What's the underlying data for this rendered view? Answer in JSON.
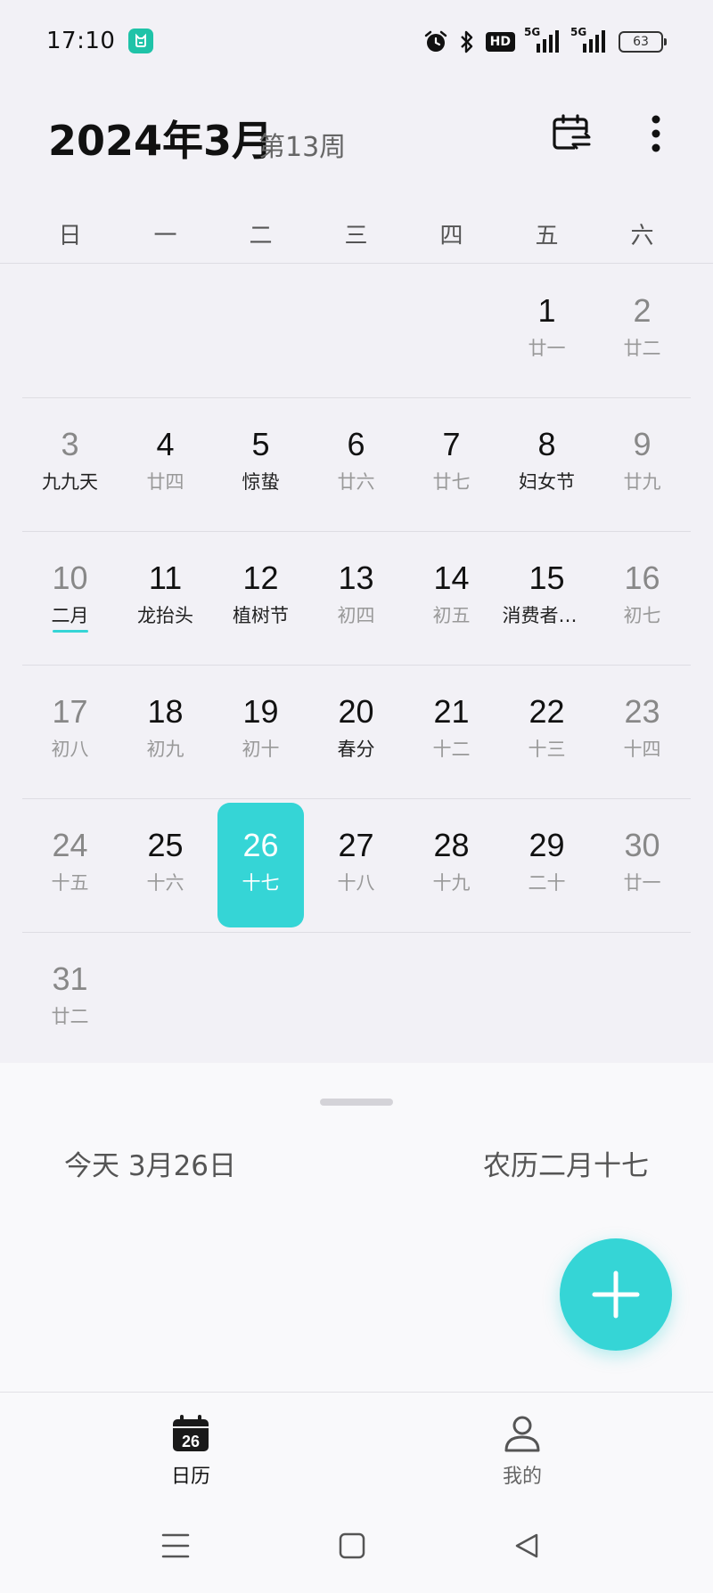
{
  "status_bar": {
    "time": "17:10",
    "hd_label": "HD",
    "sim1_label": "5G",
    "sim2_label": "5G",
    "battery": "63"
  },
  "header": {
    "title": "2024年3月",
    "week": "第13周"
  },
  "weekdays": [
    "日",
    "一",
    "二",
    "三",
    "四",
    "五",
    "六"
  ],
  "weeks": [
    [
      {
        "day": "",
        "lunar": ""
      },
      {
        "day": "",
        "lunar": ""
      },
      {
        "day": "",
        "lunar": ""
      },
      {
        "day": "",
        "lunar": ""
      },
      {
        "day": "",
        "lunar": ""
      },
      {
        "day": "1",
        "lunar": "廿一"
      },
      {
        "day": "2",
        "lunar": "廿二"
      }
    ],
    [
      {
        "day": "3",
        "lunar": "九九天",
        "festival": true
      },
      {
        "day": "4",
        "lunar": "廿四"
      },
      {
        "day": "5",
        "lunar": "惊蛰",
        "festival": true
      },
      {
        "day": "6",
        "lunar": "廿六"
      },
      {
        "day": "7",
        "lunar": "廿七"
      },
      {
        "day": "8",
        "lunar": "妇女节",
        "festival": true
      },
      {
        "day": "9",
        "lunar": "廿九"
      }
    ],
    [
      {
        "day": "10",
        "lunar": "二月",
        "festival": true,
        "month_start": true
      },
      {
        "day": "11",
        "lunar": "龙抬头",
        "festival": true
      },
      {
        "day": "12",
        "lunar": "植树节",
        "festival": true
      },
      {
        "day": "13",
        "lunar": "初四"
      },
      {
        "day": "14",
        "lunar": "初五"
      },
      {
        "day": "15",
        "lunar": "消费者权益日",
        "festival": true
      },
      {
        "day": "16",
        "lunar": "初七"
      }
    ],
    [
      {
        "day": "17",
        "lunar": "初八"
      },
      {
        "day": "18",
        "lunar": "初九"
      },
      {
        "day": "19",
        "lunar": "初十"
      },
      {
        "day": "20",
        "lunar": "春分",
        "festival": true
      },
      {
        "day": "21",
        "lunar": "十二"
      },
      {
        "day": "22",
        "lunar": "十三"
      },
      {
        "day": "23",
        "lunar": "十四"
      }
    ],
    [
      {
        "day": "24",
        "lunar": "十五"
      },
      {
        "day": "25",
        "lunar": "十六"
      },
      {
        "day": "26",
        "lunar": "十七",
        "selected": true
      },
      {
        "day": "27",
        "lunar": "十八"
      },
      {
        "day": "28",
        "lunar": "十九"
      },
      {
        "day": "29",
        "lunar": "二十"
      },
      {
        "day": "30",
        "lunar": "廿一"
      }
    ],
    [
      {
        "day": "31",
        "lunar": "廿二"
      },
      {
        "day": "",
        "lunar": ""
      },
      {
        "day": "",
        "lunar": ""
      },
      {
        "day": "",
        "lunar": ""
      },
      {
        "day": "",
        "lunar": ""
      },
      {
        "day": "",
        "lunar": ""
      },
      {
        "day": "",
        "lunar": ""
      }
    ]
  ],
  "panel": {
    "today": "今天  3月26日",
    "lunar_date": "农历二月十七"
  },
  "tabs": {
    "calendar_label": "日历",
    "calendar_icon_day": "26",
    "mine_label": "我的"
  },
  "colors": {
    "accent": "#35d5d6"
  }
}
